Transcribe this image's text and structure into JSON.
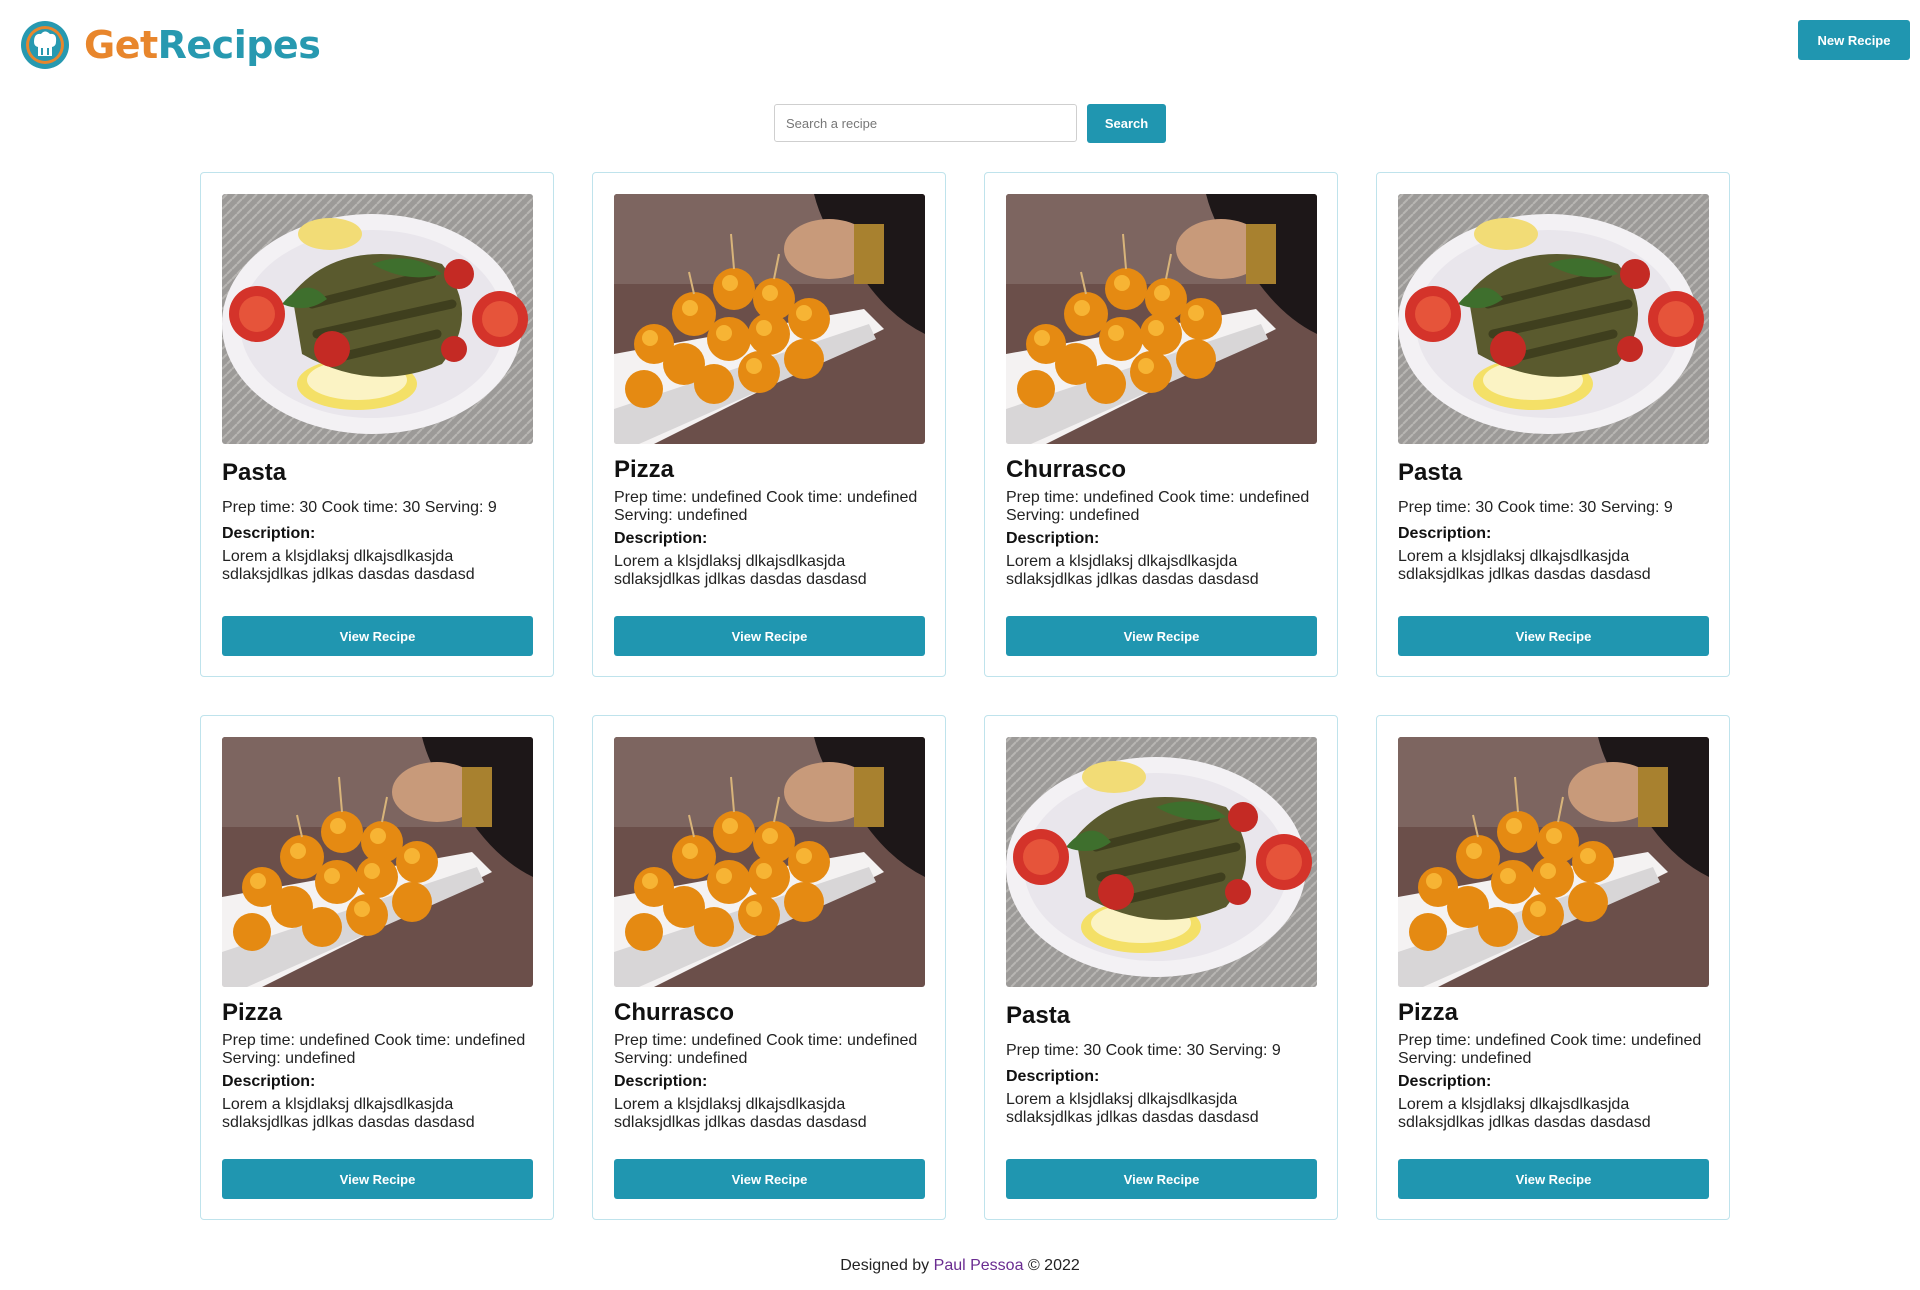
{
  "header": {
    "logo_get": "Get",
    "logo_recipes": "Recipes",
    "new_recipe_label": "New Recipe"
  },
  "search": {
    "placeholder": "Search a recipe",
    "button_label": "Search"
  },
  "recipes": [
    {
      "title": "Pasta",
      "meta": "Prep time: 30 Cook time: 30 Serving: 9",
      "description_label": "Description:",
      "description": "Lorem a klsjdlaksj dlkajsdlkasjda sdlaksjdlkas jdlkas dasdas dasdasd",
      "image": "stuffed-leaves-plate",
      "button_label": "View Recipe"
    },
    {
      "title": "Pizza",
      "meta": "Prep time: undefined Cook time: undefined Serving: undefined",
      "description_label": "Description:",
      "description": "Lorem a klsjdlaksj dlkajsdlkasjda sdlaksjdlkas jdlkas dasdas dasdasd",
      "image": "fried-balls-tray",
      "button_label": "View Recipe"
    },
    {
      "title": "Churrasco",
      "meta": "Prep time: undefined Cook time: undefined Serving: undefined",
      "description_label": "Description:",
      "description": "Lorem a klsjdlaksj dlkajsdlkasjda sdlaksjdlkas jdlkas dasdas dasdasd",
      "image": "fried-balls-tray",
      "button_label": "View Recipe"
    },
    {
      "title": "Pasta",
      "meta": "Prep time: 30 Cook time: 30 Serving: 9",
      "description_label": "Description:",
      "description": "Lorem a klsjdlaksj dlkajsdlkasjda sdlaksjdlkas jdlkas dasdas dasdasd",
      "image": "stuffed-leaves-plate",
      "button_label": "View Recipe"
    },
    {
      "title": "Pizza",
      "meta": "Prep time: undefined Cook time: undefined Serving: undefined",
      "description_label": "Description:",
      "description": "Lorem a klsjdlaksj dlkajsdlkasjda sdlaksjdlkas jdlkas dasdas dasdasd",
      "image": "fried-balls-tray",
      "button_label": "View Recipe"
    },
    {
      "title": "Churrasco",
      "meta": "Prep time: undefined Cook time: undefined Serving: undefined",
      "description_label": "Description:",
      "description": "Lorem a klsjdlaksj dlkajsdlkasjda sdlaksjdlkas jdlkas dasdas dasdasd",
      "image": "fried-balls-tray",
      "button_label": "View Recipe"
    },
    {
      "title": "Pasta",
      "meta": "Prep time: 30 Cook time: 30 Serving: 9",
      "description_label": "Description:",
      "description": "Lorem a klsjdlaksj dlkajsdlkasjda sdlaksjdlkas jdlkas dasdas dasdasd",
      "image": "stuffed-leaves-plate",
      "button_label": "View Recipe"
    },
    {
      "title": "Pizza",
      "meta": "Prep time: undefined Cook time: undefined Serving: undefined",
      "description_label": "Description:",
      "description": "Lorem a klsjdlaksj dlkajsdlkasjda sdlaksjdlkas jdlkas dasdas dasdasd",
      "image": "fried-balls-tray",
      "button_label": "View Recipe"
    }
  ],
  "footer": {
    "prefix": "Designed by",
    "author": "Paul Pessoa",
    "suffix": "© 2022"
  },
  "colors": {
    "primary": "#2096b0",
    "logo_orange": "#e8862c",
    "card_border": "#bfe3ec",
    "footer_link": "#6a2c91"
  }
}
